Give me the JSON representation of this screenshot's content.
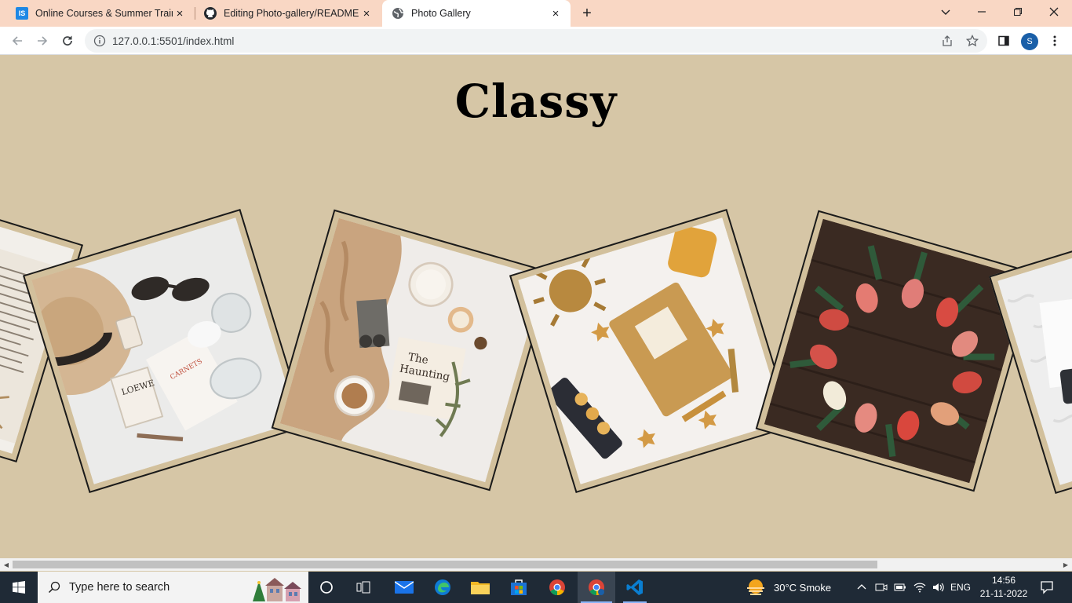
{
  "browser": {
    "tabs": [
      {
        "title": "Online Courses & Summer Traini",
        "favicon": "is-logo-icon",
        "active": false
      },
      {
        "title": "Editing Photo-gallery/README.m",
        "favicon": "github-icon",
        "active": false
      },
      {
        "title": "Photo Gallery",
        "favicon": "globe-icon",
        "active": true
      }
    ],
    "close_glyph": "×",
    "new_tab_glyph": "+",
    "url": "127.0.0.1:5501/index.html",
    "profile_initial": "S"
  },
  "page": {
    "title": "Classy",
    "background_color": "#d6c6a6",
    "photos": [
      {
        "subject": "open book with text"
      },
      {
        "subject": "hat, sunglasses, perfume bottle and glasses on white"
      },
      {
        "subject": "knit blanket, camera, candles, book and coffee"
      },
      {
        "subject": "notebook, sun ornament, stars and lanterns"
      },
      {
        "subject": "red and white tulips on dark wood"
      },
      {
        "subject": "white fur with card"
      }
    ]
  },
  "taskbar": {
    "search_placeholder": "Type here to search",
    "weather": "30°C  Smoke",
    "language": "ENG",
    "time": "14:56",
    "date": "21-11-2022"
  }
}
